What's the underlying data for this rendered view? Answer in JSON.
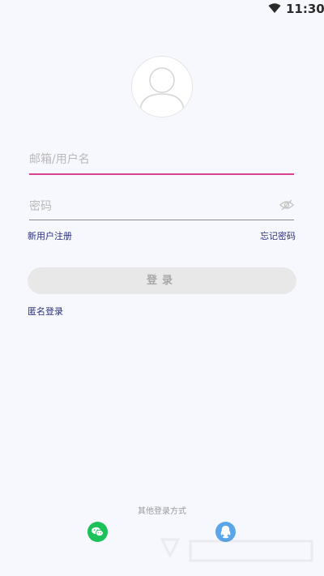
{
  "status_bar": {
    "time": "11:30",
    "wifi_icon": "wifi-icon"
  },
  "avatar": {
    "icon": "default-user-avatar-icon"
  },
  "form": {
    "username_placeholder": "邮箱/用户名",
    "password_placeholder": "密码",
    "password_visibility_icon": "eye-off-icon"
  },
  "links": {
    "register": "新用户注册",
    "forgot_password": "忘记密码",
    "anonymous_login": "匿名登录"
  },
  "login_button": {
    "label": "登录"
  },
  "other_login": {
    "title": "其他登录方式",
    "methods": [
      {
        "name": "wechat",
        "icon": "wechat-icon",
        "color": "#1bc258"
      },
      {
        "name": "qq",
        "icon": "qq-icon",
        "color": "#5aa6e8"
      }
    ]
  },
  "colors": {
    "background": "#f7f8fd",
    "accent": "#d8448f",
    "link": "#2a2f7c",
    "button_bg": "#e8e8e8",
    "button_text": "#a7a7a7"
  }
}
